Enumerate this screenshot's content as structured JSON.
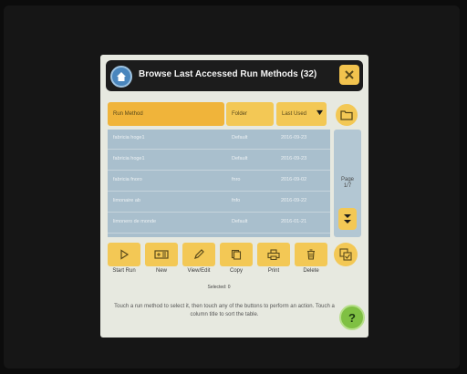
{
  "window": {
    "title": "Browse Last Accessed Run Methods (32)"
  },
  "table": {
    "headers": [
      "Run Method",
      "Folder",
      "Last Used"
    ],
    "rows": [
      {
        "method": "fabricia hoge1",
        "folder": "Default",
        "date": "2016-09-23"
      },
      {
        "method": "fabricia hoge1",
        "folder": "Default",
        "date": "2016-09-23"
      },
      {
        "method": "fabricia fnoro",
        "folder": "fnro",
        "date": "2016-09-02"
      },
      {
        "method": "limonaire ab",
        "folder": "fnfo",
        "date": "2016-09-22"
      },
      {
        "method": "limonero de monde",
        "folder": "Default",
        "date": "2016-01-21"
      }
    ]
  },
  "pager": {
    "label": "Page",
    "value": "1/7"
  },
  "toolbar": {
    "buttons": [
      {
        "label": "Start Run",
        "icon": "play-icon"
      },
      {
        "label": "New",
        "icon": "new-method-icon"
      },
      {
        "label": "View/Edit",
        "icon": "pencil-icon"
      },
      {
        "label": "Copy",
        "icon": "copy-icon"
      },
      {
        "label": "Print",
        "icon": "printer-icon"
      },
      {
        "label": "Delete",
        "icon": "trash-icon"
      }
    ]
  },
  "selection": {
    "text": "Selected: 0"
  },
  "hint": "Touch a run method to select it, then touch any of the buttons to perform an action. Touch a column title to sort the table.",
  "colors": {
    "accent": "#f3c855",
    "title_bar": "#1c1c1c",
    "table_body": "#a9bfcd",
    "home": "#4a86bd",
    "help": "#7fc043"
  }
}
